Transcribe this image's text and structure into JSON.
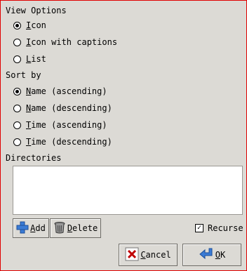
{
  "view_options": {
    "label": "View Options",
    "items": [
      {
        "label": "Icon",
        "selected": true
      },
      {
        "label": "Icon with captions",
        "selected": false
      },
      {
        "label": "List",
        "selected": false
      }
    ]
  },
  "sort_by": {
    "label": "Sort by",
    "items": [
      {
        "label": "Name (ascending)",
        "selected": true
      },
      {
        "label": "Name (descending)",
        "selected": false
      },
      {
        "label": "Time (ascending)",
        "selected": false
      },
      {
        "label": "Time (descending)",
        "selected": false
      }
    ]
  },
  "directories": {
    "label": "Directories",
    "entries": [],
    "add_label": "Add",
    "delete_label": "Delete",
    "recurse_label": "Recurse",
    "recurse_checked": true
  },
  "buttons": {
    "cancel_label": "Cancel",
    "ok_label": "OK"
  },
  "icons": {
    "add": "plus-icon",
    "delete": "trash-can-icon",
    "cancel": "cancel-x-icon",
    "ok": "ok-arrow-icon"
  },
  "colors": {
    "background": "#dcdad5",
    "window_border": "#e00000",
    "add_icon": "#3a7bd5",
    "cancel_icon": "#c00000",
    "ok_icon": "#3a7bd5"
  }
}
